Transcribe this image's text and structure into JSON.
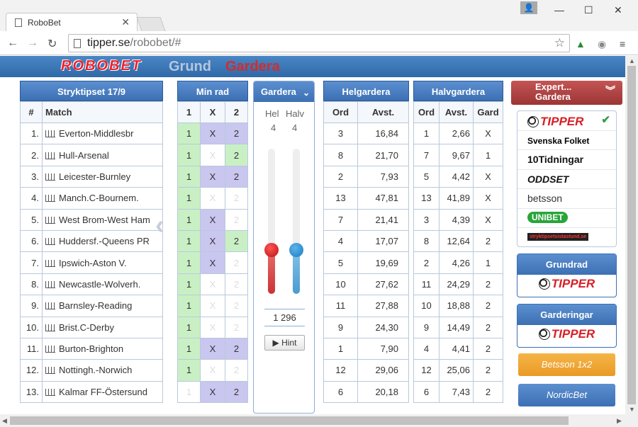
{
  "browser": {
    "tab_title": "RoboBet",
    "url_host": "tipper.se",
    "url_path": "/robobet/#"
  },
  "header": {
    "logo": "ROBOBET",
    "nav": [
      "Grund",
      "Gardera"
    ]
  },
  "stryktips": {
    "title": "Stryktipset 17/9",
    "col_num": "#",
    "col_match": "Match",
    "matches": [
      "Everton-Middlesbr",
      "Hull-Arsenal",
      "Leicester-Burnley",
      "Manch.C-Bournem.",
      "West Brom-West Ham",
      "Huddersf.-Queens PR",
      "Ipswich-Aston V.",
      "Newcastle-Wolverh.",
      "Barnsley-Reading",
      "Brist.C-Derby",
      "Burton-Brighton",
      "Nottingh.-Norwich",
      "Kalmar FF-Östersund"
    ]
  },
  "minrad": {
    "title": "Min rad",
    "cols": [
      "1",
      "X",
      "2"
    ],
    "rows": [
      [
        1,
        1,
        1
      ],
      [
        1,
        0,
        1
      ],
      [
        1,
        1,
        1
      ],
      [
        1,
        0,
        0
      ],
      [
        1,
        1,
        0
      ],
      [
        1,
        1,
        1
      ],
      [
        1,
        1,
        0
      ],
      [
        1,
        0,
        0
      ],
      [
        1,
        0,
        0
      ],
      [
        1,
        0,
        0
      ],
      [
        1,
        1,
        1
      ],
      [
        1,
        0,
        0
      ],
      [
        0,
        1,
        1
      ]
    ]
  },
  "gardera": {
    "title": "Gardera",
    "hel_label": "Hel",
    "halv_label": "Halv",
    "hel_value": "4",
    "halv_value": "4",
    "total": "1 296",
    "hint_label": "Hint"
  },
  "helgardera": {
    "title": "Helgardera",
    "cols": [
      "Ord",
      "Avst."
    ],
    "rows": [
      [
        "3",
        "16,84"
      ],
      [
        "8",
        "21,70"
      ],
      [
        "2",
        "7,93"
      ],
      [
        "13",
        "47,81"
      ],
      [
        "7",
        "21,41"
      ],
      [
        "4",
        "17,07"
      ],
      [
        "5",
        "19,69"
      ],
      [
        "10",
        "27,62"
      ],
      [
        "11",
        "27,88"
      ],
      [
        "9",
        "24,30"
      ],
      [
        "1",
        "7,90"
      ],
      [
        "12",
        "29,06"
      ],
      [
        "6",
        "20,18"
      ]
    ]
  },
  "halvgardera": {
    "title": "Halvgardera",
    "cols": [
      "Ord",
      "Avst.",
      "Gard"
    ],
    "rows": [
      [
        "1",
        "2,66",
        "X"
      ],
      [
        "7",
        "9,67",
        "1"
      ],
      [
        "5",
        "4,42",
        "X"
      ],
      [
        "13",
        "41,89",
        "X"
      ],
      [
        "3",
        "4,39",
        "X"
      ],
      [
        "8",
        "12,64",
        "2"
      ],
      [
        "2",
        "4,26",
        "1"
      ],
      [
        "11",
        "24,29",
        "2"
      ],
      [
        "10",
        "18,88",
        "2"
      ],
      [
        "9",
        "14,49",
        "2"
      ],
      [
        "4",
        "4,41",
        "2"
      ],
      [
        "12",
        "25,06",
        "2"
      ],
      [
        "6",
        "7,43",
        "2"
      ]
    ]
  },
  "expert": {
    "title_line1": "Expert...",
    "title_line2": "Gardera",
    "items": [
      "TIPPER",
      "Svenska Folket",
      "10Tidningar",
      "ODDSET",
      "betsson",
      "UNIBET",
      "stryktipsetsistastund.se"
    ]
  },
  "grundrad": {
    "title": "Grundrad",
    "logo": "TIPPER"
  },
  "garderingar": {
    "title": "Garderingar",
    "logo": "TIPPER"
  },
  "buttons": {
    "betsson": "Betsson 1x2",
    "nordic": "NordicBet"
  },
  "colors": {
    "green_cell": "#c9f0c4",
    "purple_cell": "#c9c6ef",
    "header_blue": "#3c70b3",
    "expert_red": "#9c3535"
  }
}
